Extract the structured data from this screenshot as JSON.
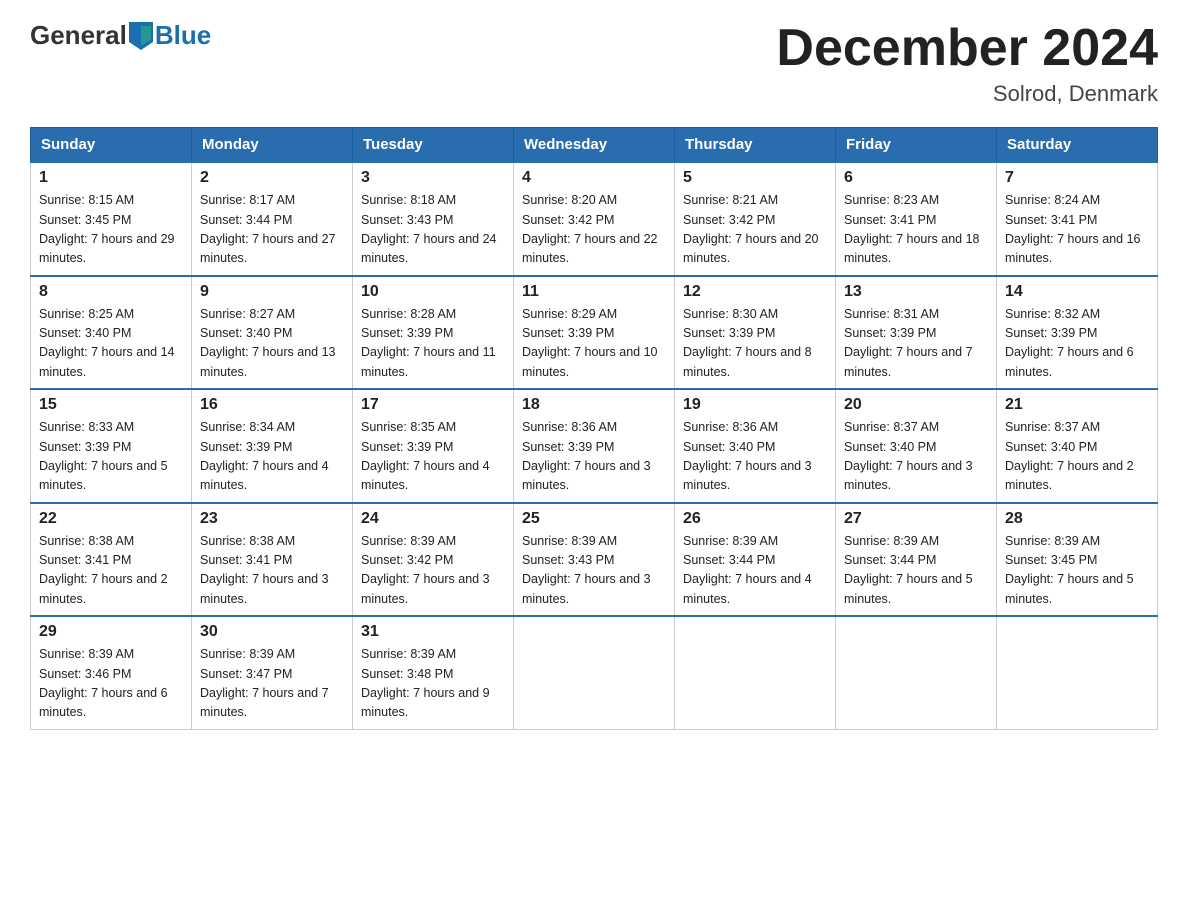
{
  "logo": {
    "general": "General",
    "blue": "Blue"
  },
  "title": "December 2024",
  "location": "Solrod, Denmark",
  "days_of_week": [
    "Sunday",
    "Monday",
    "Tuesday",
    "Wednesday",
    "Thursday",
    "Friday",
    "Saturday"
  ],
  "weeks": [
    [
      {
        "day": "1",
        "sunrise": "8:15 AM",
        "sunset": "3:45 PM",
        "daylight": "7 hours and 29 minutes."
      },
      {
        "day": "2",
        "sunrise": "8:17 AM",
        "sunset": "3:44 PM",
        "daylight": "7 hours and 27 minutes."
      },
      {
        "day": "3",
        "sunrise": "8:18 AM",
        "sunset": "3:43 PM",
        "daylight": "7 hours and 24 minutes."
      },
      {
        "day": "4",
        "sunrise": "8:20 AM",
        "sunset": "3:42 PM",
        "daylight": "7 hours and 22 minutes."
      },
      {
        "day": "5",
        "sunrise": "8:21 AM",
        "sunset": "3:42 PM",
        "daylight": "7 hours and 20 minutes."
      },
      {
        "day": "6",
        "sunrise": "8:23 AM",
        "sunset": "3:41 PM",
        "daylight": "7 hours and 18 minutes."
      },
      {
        "day": "7",
        "sunrise": "8:24 AM",
        "sunset": "3:41 PM",
        "daylight": "7 hours and 16 minutes."
      }
    ],
    [
      {
        "day": "8",
        "sunrise": "8:25 AM",
        "sunset": "3:40 PM",
        "daylight": "7 hours and 14 minutes."
      },
      {
        "day": "9",
        "sunrise": "8:27 AM",
        "sunset": "3:40 PM",
        "daylight": "7 hours and 13 minutes."
      },
      {
        "day": "10",
        "sunrise": "8:28 AM",
        "sunset": "3:39 PM",
        "daylight": "7 hours and 11 minutes."
      },
      {
        "day": "11",
        "sunrise": "8:29 AM",
        "sunset": "3:39 PM",
        "daylight": "7 hours and 10 minutes."
      },
      {
        "day": "12",
        "sunrise": "8:30 AM",
        "sunset": "3:39 PM",
        "daylight": "7 hours and 8 minutes."
      },
      {
        "day": "13",
        "sunrise": "8:31 AM",
        "sunset": "3:39 PM",
        "daylight": "7 hours and 7 minutes."
      },
      {
        "day": "14",
        "sunrise": "8:32 AM",
        "sunset": "3:39 PM",
        "daylight": "7 hours and 6 minutes."
      }
    ],
    [
      {
        "day": "15",
        "sunrise": "8:33 AM",
        "sunset": "3:39 PM",
        "daylight": "7 hours and 5 minutes."
      },
      {
        "day": "16",
        "sunrise": "8:34 AM",
        "sunset": "3:39 PM",
        "daylight": "7 hours and 4 minutes."
      },
      {
        "day": "17",
        "sunrise": "8:35 AM",
        "sunset": "3:39 PM",
        "daylight": "7 hours and 4 minutes."
      },
      {
        "day": "18",
        "sunrise": "8:36 AM",
        "sunset": "3:39 PM",
        "daylight": "7 hours and 3 minutes."
      },
      {
        "day": "19",
        "sunrise": "8:36 AM",
        "sunset": "3:40 PM",
        "daylight": "7 hours and 3 minutes."
      },
      {
        "day": "20",
        "sunrise": "8:37 AM",
        "sunset": "3:40 PM",
        "daylight": "7 hours and 3 minutes."
      },
      {
        "day": "21",
        "sunrise": "8:37 AM",
        "sunset": "3:40 PM",
        "daylight": "7 hours and 2 minutes."
      }
    ],
    [
      {
        "day": "22",
        "sunrise": "8:38 AM",
        "sunset": "3:41 PM",
        "daylight": "7 hours and 2 minutes."
      },
      {
        "day": "23",
        "sunrise": "8:38 AM",
        "sunset": "3:41 PM",
        "daylight": "7 hours and 3 minutes."
      },
      {
        "day": "24",
        "sunrise": "8:39 AM",
        "sunset": "3:42 PM",
        "daylight": "7 hours and 3 minutes."
      },
      {
        "day": "25",
        "sunrise": "8:39 AM",
        "sunset": "3:43 PM",
        "daylight": "7 hours and 3 minutes."
      },
      {
        "day": "26",
        "sunrise": "8:39 AM",
        "sunset": "3:44 PM",
        "daylight": "7 hours and 4 minutes."
      },
      {
        "day": "27",
        "sunrise": "8:39 AM",
        "sunset": "3:44 PM",
        "daylight": "7 hours and 5 minutes."
      },
      {
        "day": "28",
        "sunrise": "8:39 AM",
        "sunset": "3:45 PM",
        "daylight": "7 hours and 5 minutes."
      }
    ],
    [
      {
        "day": "29",
        "sunrise": "8:39 AM",
        "sunset": "3:46 PM",
        "daylight": "7 hours and 6 minutes."
      },
      {
        "day": "30",
        "sunrise": "8:39 AM",
        "sunset": "3:47 PM",
        "daylight": "7 hours and 7 minutes."
      },
      {
        "day": "31",
        "sunrise": "8:39 AM",
        "sunset": "3:48 PM",
        "daylight": "7 hours and 9 minutes."
      },
      null,
      null,
      null,
      null
    ]
  ]
}
